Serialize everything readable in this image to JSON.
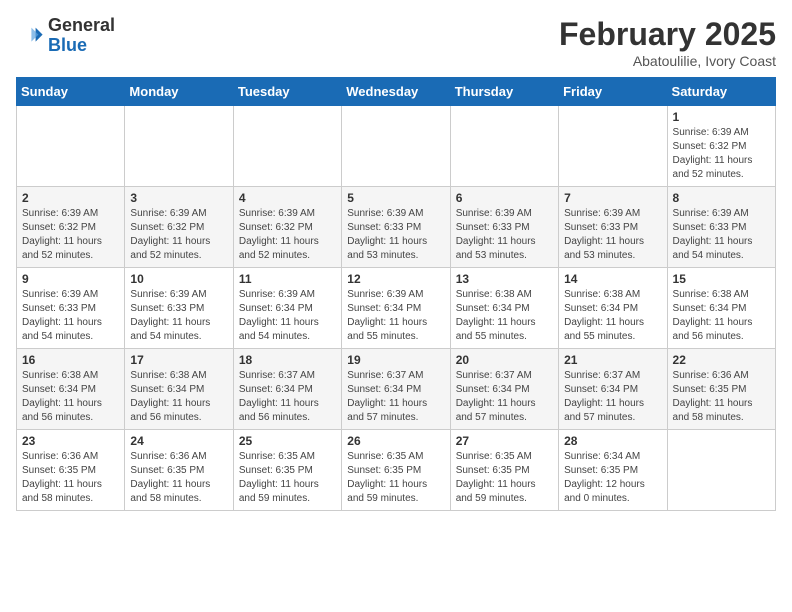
{
  "header": {
    "logo_line1": "General",
    "logo_line2": "Blue",
    "month_title": "February 2025",
    "subtitle": "Abatoulilie, Ivory Coast"
  },
  "weekdays": [
    "Sunday",
    "Monday",
    "Tuesday",
    "Wednesday",
    "Thursday",
    "Friday",
    "Saturday"
  ],
  "weeks": [
    [
      {
        "day": "",
        "info": ""
      },
      {
        "day": "",
        "info": ""
      },
      {
        "day": "",
        "info": ""
      },
      {
        "day": "",
        "info": ""
      },
      {
        "day": "",
        "info": ""
      },
      {
        "day": "",
        "info": ""
      },
      {
        "day": "1",
        "info": "Sunrise: 6:39 AM\nSunset: 6:32 PM\nDaylight: 11 hours and 52 minutes."
      }
    ],
    [
      {
        "day": "2",
        "info": "Sunrise: 6:39 AM\nSunset: 6:32 PM\nDaylight: 11 hours and 52 minutes."
      },
      {
        "day": "3",
        "info": "Sunrise: 6:39 AM\nSunset: 6:32 PM\nDaylight: 11 hours and 52 minutes."
      },
      {
        "day": "4",
        "info": "Sunrise: 6:39 AM\nSunset: 6:32 PM\nDaylight: 11 hours and 52 minutes."
      },
      {
        "day": "5",
        "info": "Sunrise: 6:39 AM\nSunset: 6:33 PM\nDaylight: 11 hours and 53 minutes."
      },
      {
        "day": "6",
        "info": "Sunrise: 6:39 AM\nSunset: 6:33 PM\nDaylight: 11 hours and 53 minutes."
      },
      {
        "day": "7",
        "info": "Sunrise: 6:39 AM\nSunset: 6:33 PM\nDaylight: 11 hours and 53 minutes."
      },
      {
        "day": "8",
        "info": "Sunrise: 6:39 AM\nSunset: 6:33 PM\nDaylight: 11 hours and 54 minutes."
      }
    ],
    [
      {
        "day": "9",
        "info": "Sunrise: 6:39 AM\nSunset: 6:33 PM\nDaylight: 11 hours and 54 minutes."
      },
      {
        "day": "10",
        "info": "Sunrise: 6:39 AM\nSunset: 6:33 PM\nDaylight: 11 hours and 54 minutes."
      },
      {
        "day": "11",
        "info": "Sunrise: 6:39 AM\nSunset: 6:34 PM\nDaylight: 11 hours and 54 minutes."
      },
      {
        "day": "12",
        "info": "Sunrise: 6:39 AM\nSunset: 6:34 PM\nDaylight: 11 hours and 55 minutes."
      },
      {
        "day": "13",
        "info": "Sunrise: 6:38 AM\nSunset: 6:34 PM\nDaylight: 11 hours and 55 minutes."
      },
      {
        "day": "14",
        "info": "Sunrise: 6:38 AM\nSunset: 6:34 PM\nDaylight: 11 hours and 55 minutes."
      },
      {
        "day": "15",
        "info": "Sunrise: 6:38 AM\nSunset: 6:34 PM\nDaylight: 11 hours and 56 minutes."
      }
    ],
    [
      {
        "day": "16",
        "info": "Sunrise: 6:38 AM\nSunset: 6:34 PM\nDaylight: 11 hours and 56 minutes."
      },
      {
        "day": "17",
        "info": "Sunrise: 6:38 AM\nSunset: 6:34 PM\nDaylight: 11 hours and 56 minutes."
      },
      {
        "day": "18",
        "info": "Sunrise: 6:37 AM\nSunset: 6:34 PM\nDaylight: 11 hours and 56 minutes."
      },
      {
        "day": "19",
        "info": "Sunrise: 6:37 AM\nSunset: 6:34 PM\nDaylight: 11 hours and 57 minutes."
      },
      {
        "day": "20",
        "info": "Sunrise: 6:37 AM\nSunset: 6:34 PM\nDaylight: 11 hours and 57 minutes."
      },
      {
        "day": "21",
        "info": "Sunrise: 6:37 AM\nSunset: 6:34 PM\nDaylight: 11 hours and 57 minutes."
      },
      {
        "day": "22",
        "info": "Sunrise: 6:36 AM\nSunset: 6:35 PM\nDaylight: 11 hours and 58 minutes."
      }
    ],
    [
      {
        "day": "23",
        "info": "Sunrise: 6:36 AM\nSunset: 6:35 PM\nDaylight: 11 hours and 58 minutes."
      },
      {
        "day": "24",
        "info": "Sunrise: 6:36 AM\nSunset: 6:35 PM\nDaylight: 11 hours and 58 minutes."
      },
      {
        "day": "25",
        "info": "Sunrise: 6:35 AM\nSunset: 6:35 PM\nDaylight: 11 hours and 59 minutes."
      },
      {
        "day": "26",
        "info": "Sunrise: 6:35 AM\nSunset: 6:35 PM\nDaylight: 11 hours and 59 minutes."
      },
      {
        "day": "27",
        "info": "Sunrise: 6:35 AM\nSunset: 6:35 PM\nDaylight: 11 hours and 59 minutes."
      },
      {
        "day": "28",
        "info": "Sunrise: 6:34 AM\nSunset: 6:35 PM\nDaylight: 12 hours and 0 minutes."
      },
      {
        "day": "",
        "info": ""
      }
    ]
  ]
}
